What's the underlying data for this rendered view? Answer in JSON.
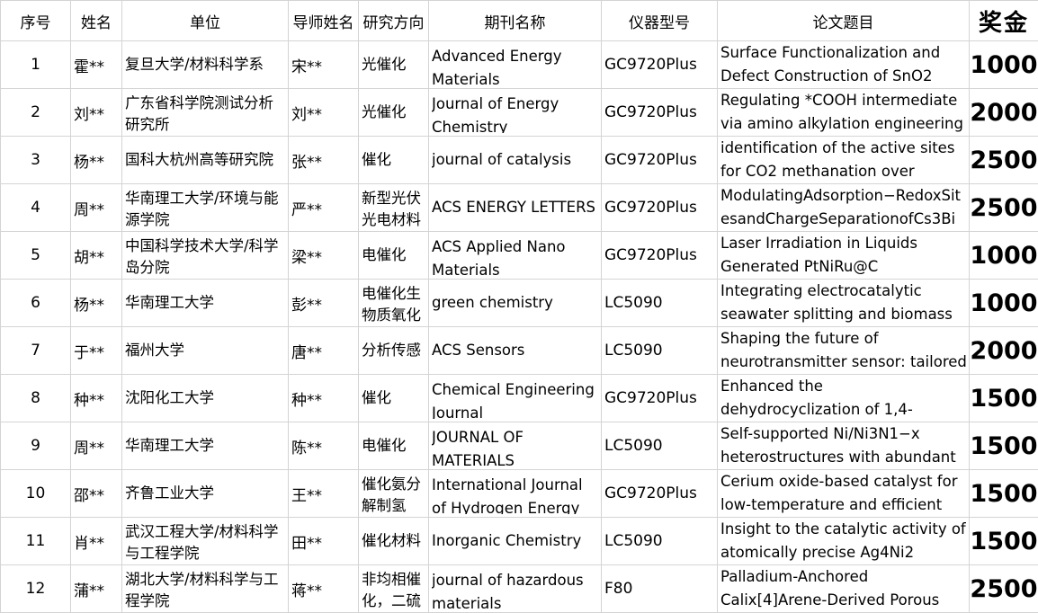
{
  "headers": {
    "index": "序号",
    "name": "姓名",
    "unit": "单位",
    "advisor": "导师姓名",
    "field": "研究方向",
    "journal": "期刊名称",
    "instrument": "仪器型号",
    "title": "论文题目",
    "award": "奖金"
  },
  "rows": [
    {
      "index": "1",
      "name": "霍**",
      "unit": "复旦大学/材料科学系",
      "advisor": "宋**",
      "field": "光催化",
      "journal": "Advanced Energy Materials",
      "instrument": "GC9720Plus",
      "title_l1": "Surface Functionalization and",
      "title_l2": "Defect Construction of SnO2",
      "award": "1000"
    },
    {
      "index": "2",
      "name": "刘**",
      "unit": "广东省科学院测试分析研究所",
      "advisor": "刘**",
      "field": "光催化",
      "journal": "Journal of Energy Chemistry",
      "instrument": "GC9720Plus",
      "title_l1": "Regulating *COOH intermediate",
      "title_l2": "via amino alkylation engineering",
      "award": "2000"
    },
    {
      "index": "3",
      "name": "杨**",
      "unit": "国科大杭州高等研究院",
      "advisor": "张**",
      "field": "催化",
      "journal": "journal of catalysis",
      "instrument": "GC9720Plus",
      "title_l1": "identification of the active sites",
      "title_l2": "for CO2 methanation over",
      "award": "2500"
    },
    {
      "index": "4",
      "name": "周**",
      "unit": "华南理工大学/环境与能源学院",
      "advisor": "严**",
      "field": "新型光伏光电材料",
      "journal": "ACS ENERGY LETTERS",
      "instrument": "GC9720Plus",
      "title_l1": "ModulatingAdsorption−RedoxSit",
      "title_l2": "esandChargeSeparationofCs3Bi",
      "award": "2500"
    },
    {
      "index": "5",
      "name": "胡**",
      "unit": "中国科学技术大学/科学岛分院",
      "advisor": "梁**",
      "field": "电催化",
      "journal": "ACS Applied Nano Materials",
      "instrument": "GC9720Plus",
      "title_l1": "Laser Irradiation in Liquids",
      "title_l2": "Generated PtNiRu@C",
      "award": "1000"
    },
    {
      "index": "6",
      "name": "杨**",
      "unit": "华南理工大学",
      "advisor": "彭**",
      "field": "电催化生物质氧化",
      "journal": "green chemistry",
      "instrument": "LC5090",
      "title_l1": "Integrating electrocatalytic",
      "title_l2": "seawater splitting and biomass",
      "award": "1000"
    },
    {
      "index": "7",
      "name": "于**",
      "unit": "福州大学",
      "advisor": "唐**",
      "field": "分析传感",
      "journal": "ACS Sensors",
      "instrument": "LC5090",
      "title_l1": "Shaping the future of",
      "title_l2": "neurotransmitter sensor: tailored",
      "award": "2000"
    },
    {
      "index": "8",
      "name": "种**",
      "unit": "沈阳化工大学",
      "advisor": "种**",
      "field": "催化",
      "journal": "Chemical Engineering Journal",
      "instrument": "GC9720Plus",
      "title_l1": "Enhanced the",
      "title_l2": "dehydrocyclization of 1,4-",
      "award": "1500"
    },
    {
      "index": "9",
      "name": "周**",
      "unit": "华南理工大学",
      "advisor": "陈**",
      "field": "电催化",
      "journal": "JOURNAL OF MATERIALS",
      "instrument": "LC5090",
      "title_l1": "Self-supported Ni/Ni3N1−x",
      "title_l2": "heterostructures with abundant",
      "award": "1500"
    },
    {
      "index": "10",
      "name": "邵**",
      "unit": "齐鲁工业大学",
      "advisor": "王**",
      "field": "催化氨分解制氢",
      "journal": "International Journal of Hydrogen Energy",
      "instrument": "GC9720Plus",
      "title_l1": "Cerium oxide-based catalyst for",
      "title_l2": "low-temperature and efficient",
      "award": "1500"
    },
    {
      "index": "11",
      "name": "肖**",
      "unit": "武汉工程大学/材料科学与工程学院",
      "advisor": "田**",
      "field": "催化材料",
      "journal": "Inorganic Chemistry",
      "instrument": "LC5090",
      "title_l1": "Insight to the catalytic activity of",
      "title_l2": "atomically precise Ag4Ni2",
      "award": "1500"
    },
    {
      "index": "12",
      "name": "蒲**",
      "unit": "湖北大学/材料科学与工程学院",
      "advisor": "蒋**",
      "field": "非均相催化，二硫",
      "journal": "journal of hazardous materials",
      "instrument": "F80",
      "title_l1": "Palladium-Anchored",
      "title_l2": "Calix[4]Arene-Derived Porous",
      "award": "2500"
    }
  ]
}
